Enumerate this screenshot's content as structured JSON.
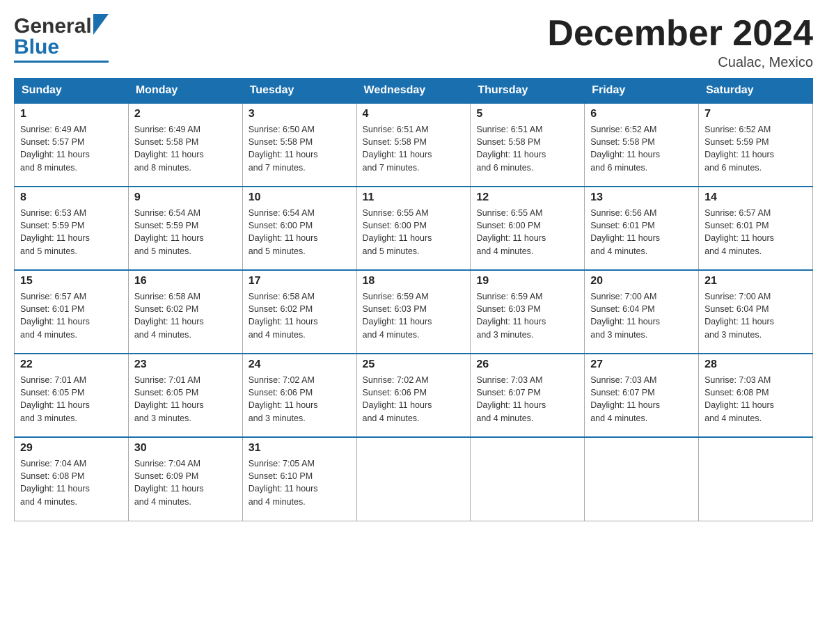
{
  "header": {
    "title": "December 2024",
    "location": "Cualac, Mexico",
    "logo_general": "General",
    "logo_blue": "Blue"
  },
  "weekdays": [
    "Sunday",
    "Monday",
    "Tuesday",
    "Wednesday",
    "Thursday",
    "Friday",
    "Saturday"
  ],
  "weeks": [
    [
      {
        "day": "1",
        "sunrise": "6:49 AM",
        "sunset": "5:57 PM",
        "daylight": "11 hours and 8 minutes."
      },
      {
        "day": "2",
        "sunrise": "6:49 AM",
        "sunset": "5:58 PM",
        "daylight": "11 hours and 8 minutes."
      },
      {
        "day": "3",
        "sunrise": "6:50 AM",
        "sunset": "5:58 PM",
        "daylight": "11 hours and 7 minutes."
      },
      {
        "day": "4",
        "sunrise": "6:51 AM",
        "sunset": "5:58 PM",
        "daylight": "11 hours and 7 minutes."
      },
      {
        "day": "5",
        "sunrise": "6:51 AM",
        "sunset": "5:58 PM",
        "daylight": "11 hours and 6 minutes."
      },
      {
        "day": "6",
        "sunrise": "6:52 AM",
        "sunset": "5:58 PM",
        "daylight": "11 hours and 6 minutes."
      },
      {
        "day": "7",
        "sunrise": "6:52 AM",
        "sunset": "5:59 PM",
        "daylight": "11 hours and 6 minutes."
      }
    ],
    [
      {
        "day": "8",
        "sunrise": "6:53 AM",
        "sunset": "5:59 PM",
        "daylight": "11 hours and 5 minutes."
      },
      {
        "day": "9",
        "sunrise": "6:54 AM",
        "sunset": "5:59 PM",
        "daylight": "11 hours and 5 minutes."
      },
      {
        "day": "10",
        "sunrise": "6:54 AM",
        "sunset": "6:00 PM",
        "daylight": "11 hours and 5 minutes."
      },
      {
        "day": "11",
        "sunrise": "6:55 AM",
        "sunset": "6:00 PM",
        "daylight": "11 hours and 5 minutes."
      },
      {
        "day": "12",
        "sunrise": "6:55 AM",
        "sunset": "6:00 PM",
        "daylight": "11 hours and 4 minutes."
      },
      {
        "day": "13",
        "sunrise": "6:56 AM",
        "sunset": "6:01 PM",
        "daylight": "11 hours and 4 minutes."
      },
      {
        "day": "14",
        "sunrise": "6:57 AM",
        "sunset": "6:01 PM",
        "daylight": "11 hours and 4 minutes."
      }
    ],
    [
      {
        "day": "15",
        "sunrise": "6:57 AM",
        "sunset": "6:01 PM",
        "daylight": "11 hours and 4 minutes."
      },
      {
        "day": "16",
        "sunrise": "6:58 AM",
        "sunset": "6:02 PM",
        "daylight": "11 hours and 4 minutes."
      },
      {
        "day": "17",
        "sunrise": "6:58 AM",
        "sunset": "6:02 PM",
        "daylight": "11 hours and 4 minutes."
      },
      {
        "day": "18",
        "sunrise": "6:59 AM",
        "sunset": "6:03 PM",
        "daylight": "11 hours and 4 minutes."
      },
      {
        "day": "19",
        "sunrise": "6:59 AM",
        "sunset": "6:03 PM",
        "daylight": "11 hours and 3 minutes."
      },
      {
        "day": "20",
        "sunrise": "7:00 AM",
        "sunset": "6:04 PM",
        "daylight": "11 hours and 3 minutes."
      },
      {
        "day": "21",
        "sunrise": "7:00 AM",
        "sunset": "6:04 PM",
        "daylight": "11 hours and 3 minutes."
      }
    ],
    [
      {
        "day": "22",
        "sunrise": "7:01 AM",
        "sunset": "6:05 PM",
        "daylight": "11 hours and 3 minutes."
      },
      {
        "day": "23",
        "sunrise": "7:01 AM",
        "sunset": "6:05 PM",
        "daylight": "11 hours and 3 minutes."
      },
      {
        "day": "24",
        "sunrise": "7:02 AM",
        "sunset": "6:06 PM",
        "daylight": "11 hours and 3 minutes."
      },
      {
        "day": "25",
        "sunrise": "7:02 AM",
        "sunset": "6:06 PM",
        "daylight": "11 hours and 4 minutes."
      },
      {
        "day": "26",
        "sunrise": "7:03 AM",
        "sunset": "6:07 PM",
        "daylight": "11 hours and 4 minutes."
      },
      {
        "day": "27",
        "sunrise": "7:03 AM",
        "sunset": "6:07 PM",
        "daylight": "11 hours and 4 minutes."
      },
      {
        "day": "28",
        "sunrise": "7:03 AM",
        "sunset": "6:08 PM",
        "daylight": "11 hours and 4 minutes."
      }
    ],
    [
      {
        "day": "29",
        "sunrise": "7:04 AM",
        "sunset": "6:08 PM",
        "daylight": "11 hours and 4 minutes."
      },
      {
        "day": "30",
        "sunrise": "7:04 AM",
        "sunset": "6:09 PM",
        "daylight": "11 hours and 4 minutes."
      },
      {
        "day": "31",
        "sunrise": "7:05 AM",
        "sunset": "6:10 PM",
        "daylight": "11 hours and 4 minutes."
      },
      null,
      null,
      null,
      null
    ]
  ],
  "labels": {
    "sunrise": "Sunrise:",
    "sunset": "Sunset:",
    "daylight": "Daylight:"
  }
}
